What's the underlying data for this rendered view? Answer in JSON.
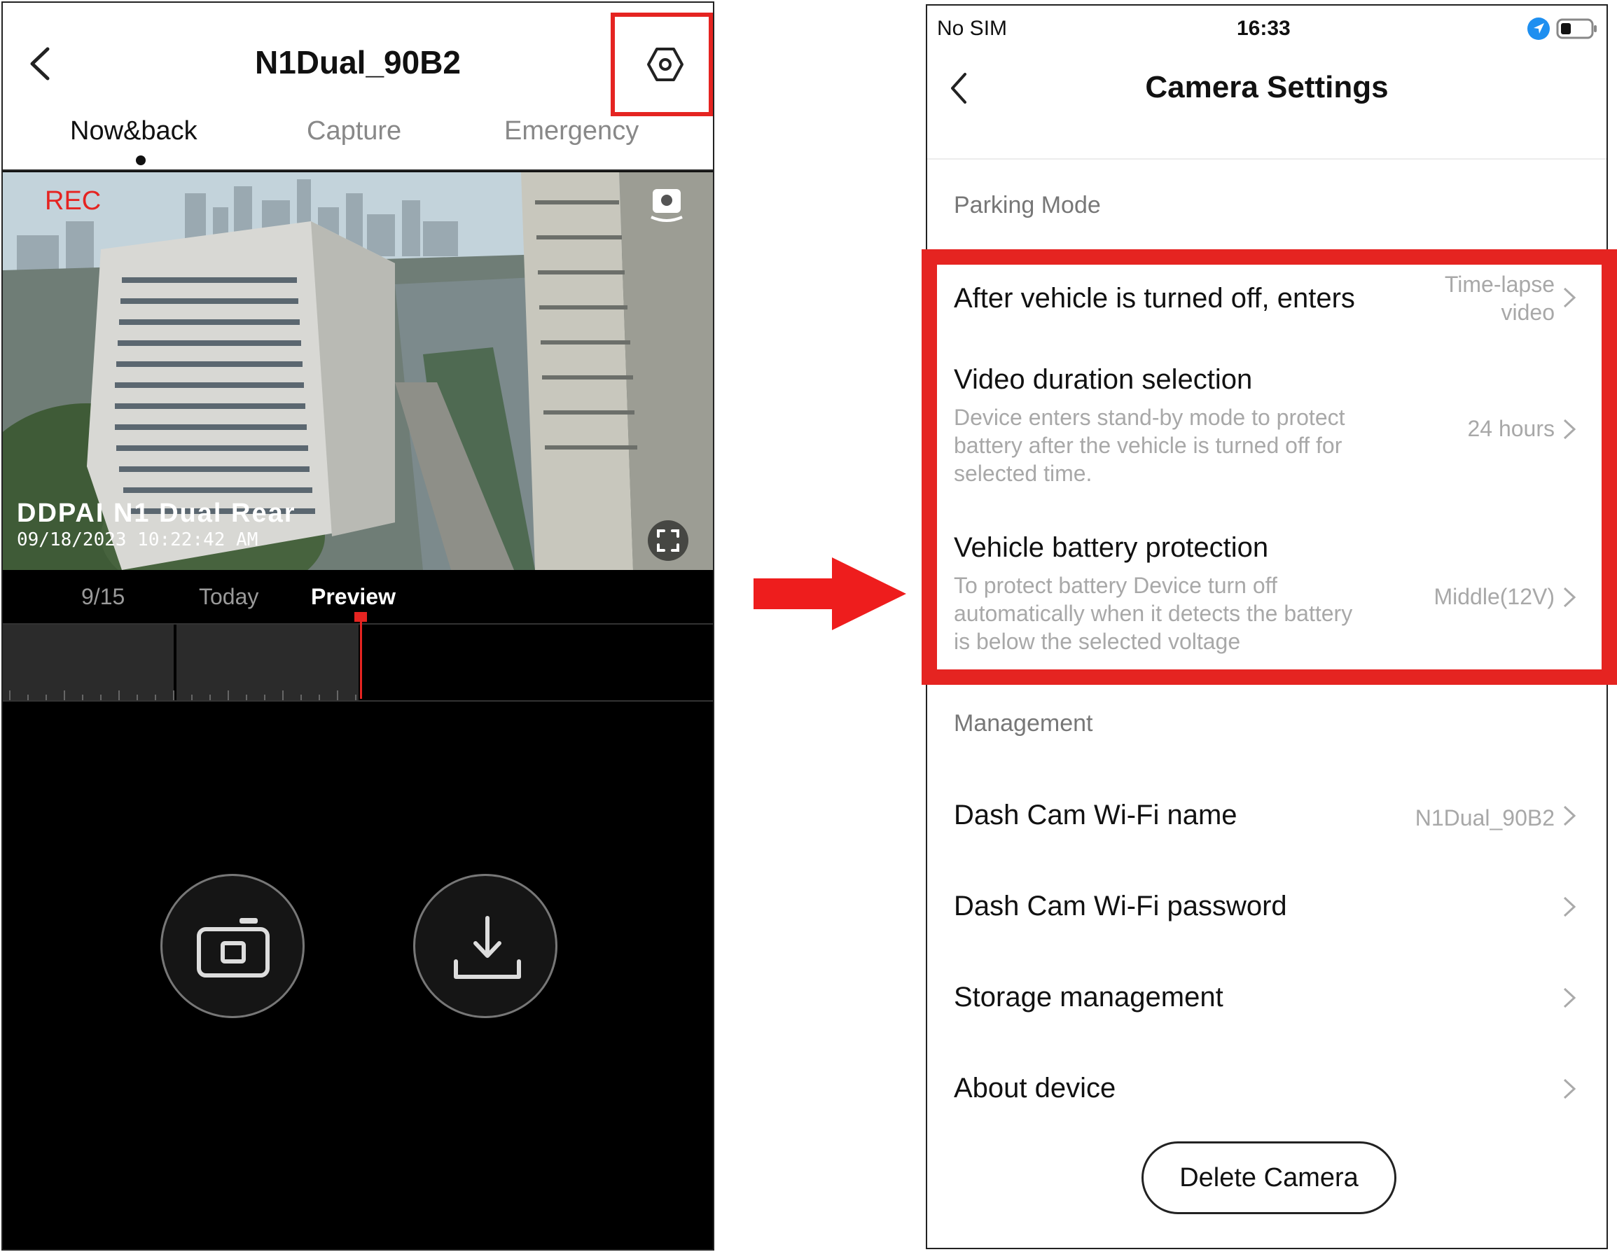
{
  "left_app": {
    "title": "N1Dual_90B2",
    "tabs": [
      {
        "label": "Now&back",
        "active": true
      },
      {
        "label": "Capture",
        "active": false
      },
      {
        "label": "Emergency",
        "active": false
      }
    ],
    "video": {
      "rec_label": "REC",
      "brand": "DDPAI N1 Dual Rear",
      "timestamp": "09/18/2023 10:22:42 AM"
    },
    "timeline": {
      "labels": [
        {
          "label": "9/15",
          "active": false
        },
        {
          "label": "Today",
          "active": false
        },
        {
          "label": "Preview",
          "active": true
        }
      ]
    },
    "icons": {
      "back": "chevron-left-icon",
      "settings": "settings-hexagon-icon",
      "switch_camera": "camera-switch-icon",
      "fullscreen": "fullscreen-icon",
      "capture": "camera-icon",
      "download": "download-icon"
    }
  },
  "right_app": {
    "status_bar": {
      "carrier": "No SIM",
      "time": "16:33"
    },
    "title": "Camera Settings",
    "sections": [
      {
        "header": "Parking Mode",
        "items": [
          {
            "title": "After vehicle is turned off, enters",
            "description": "",
            "value_lines": [
              "Time-lapse",
              "video"
            ]
          },
          {
            "title": "Video duration selection",
            "description_lines": [
              "Device enters stand-by mode to protect",
              "battery after the vehicle is turned off for",
              "selected time."
            ],
            "value": "24 hours"
          },
          {
            "title": "Vehicle battery protection",
            "description_lines": [
              "To protect battery Device turn off",
              "automatically when it detects the battery",
              "is below the selected voltage"
            ],
            "value": "Middle(12V)"
          }
        ]
      },
      {
        "header": "Management",
        "items": [
          {
            "title": "Dash Cam Wi-Fi name",
            "value": "N1Dual_90B2"
          },
          {
            "title": "Dash Cam Wi-Fi password",
            "value": ""
          },
          {
            "title": "Storage management",
            "value": ""
          },
          {
            "title": "About device",
            "value": ""
          }
        ]
      }
    ],
    "delete_button": "Delete Camera"
  },
  "colors": {
    "highlight": "#e52421",
    "location_blue": "#1e8ff0"
  }
}
